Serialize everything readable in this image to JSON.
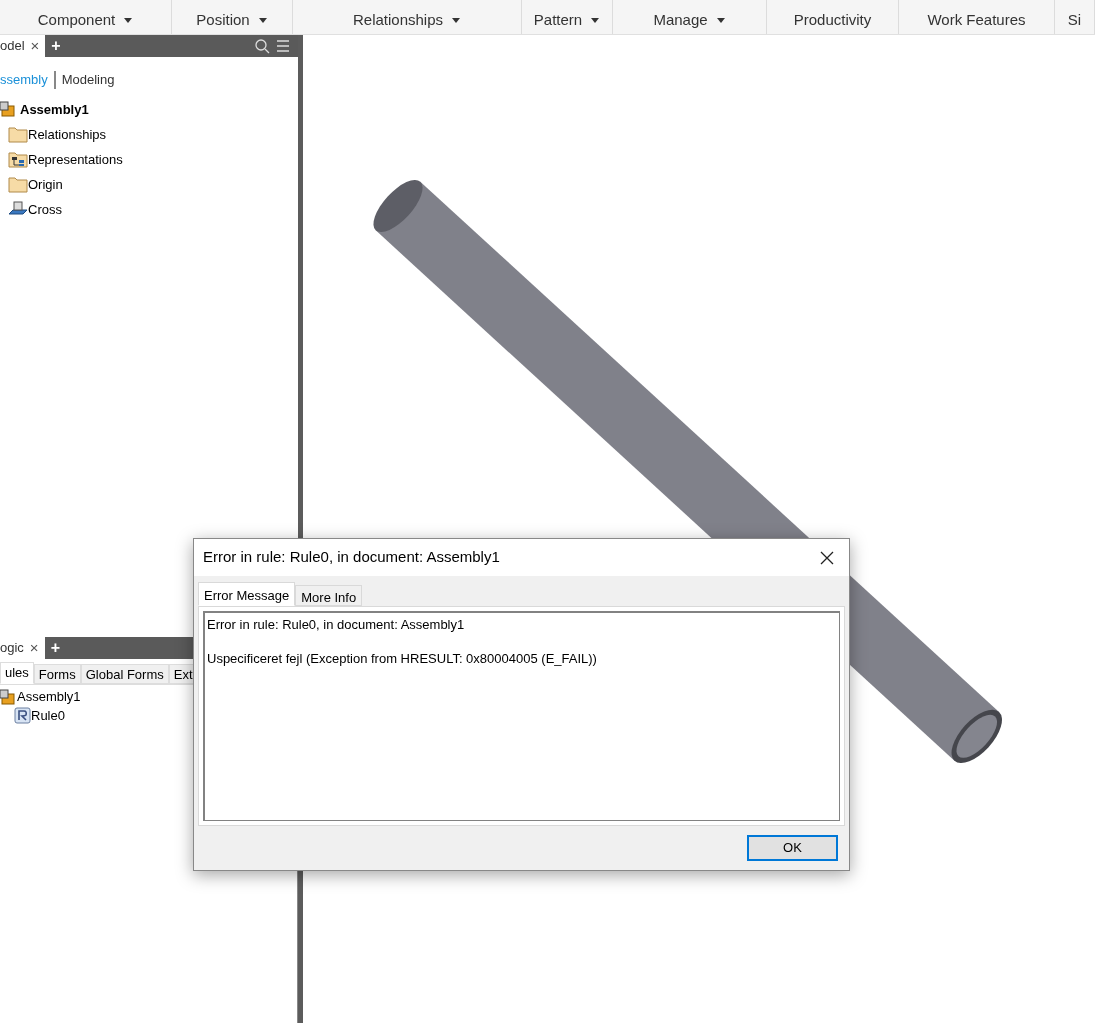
{
  "ribbon": {
    "panels": [
      {
        "label": "Component",
        "dropdown": true
      },
      {
        "label": "Position",
        "dropdown": true
      },
      {
        "label": "Relationships",
        "dropdown": true
      },
      {
        "label": "Pattern",
        "dropdown": true
      },
      {
        "label": "Manage",
        "dropdown": true
      },
      {
        "label": "Productivity",
        "dropdown": false
      },
      {
        "label": "Work Features",
        "dropdown": false
      },
      {
        "label": "Si",
        "dropdown": false
      }
    ]
  },
  "model_browser": {
    "tab": {
      "label": "odel",
      "close": "×"
    },
    "add": "+",
    "views": [
      {
        "label": "ssembly",
        "selected": true
      },
      {
        "label": "Modeling",
        "selected": false
      }
    ],
    "tree": [
      {
        "label": "Assembly1",
        "kind": "assembly",
        "children": [
          {
            "label": "Relationships",
            "kind": "folder"
          },
          {
            "label": "Representations",
            "kind": "representations"
          },
          {
            "label": "Origin",
            "kind": "folder"
          },
          {
            "label": "Cross",
            "kind": "part"
          }
        ]
      }
    ]
  },
  "ilogic_browser": {
    "tab": {
      "label": "ogic",
      "close": "×"
    },
    "add": "+",
    "tabs": [
      {
        "label": "ules",
        "selected": true
      },
      {
        "label": "Forms",
        "selected": false
      },
      {
        "label": "Global Forms",
        "selected": false
      },
      {
        "label": "Ext",
        "selected": false
      }
    ],
    "tree": [
      {
        "label": "Assembly1",
        "kind": "assembly",
        "children": [
          {
            "label": "Rule0",
            "kind": "rule"
          }
        ]
      }
    ]
  },
  "dialog": {
    "title": "Error in rule: Rule0, in document: Assembly1",
    "tabs": [
      {
        "label": "Error Message",
        "selected": true
      },
      {
        "label": "More Info",
        "selected": false
      }
    ],
    "message": [
      "Error in rule: Rule0, in document: Assembly1",
      "Uspecificeret fejl (Exception from HRESULT: 0x80004005 (E_FAIL))"
    ],
    "button": "OK"
  }
}
